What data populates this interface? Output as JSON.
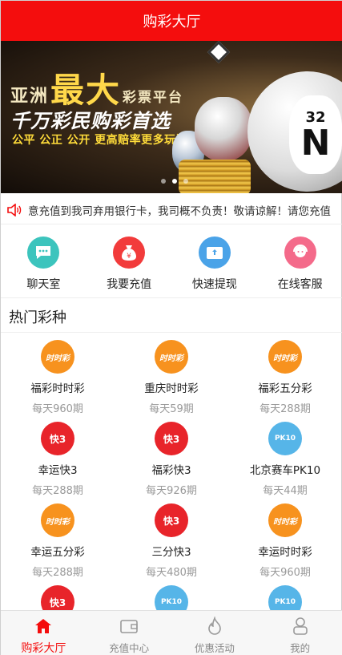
{
  "header": {
    "title": "购彩大厅"
  },
  "banner": {
    "line1_a": "亚洲",
    "line1_big": "最大",
    "line1_b": "彩票平台",
    "line2": "千万彩民购彩首选",
    "line3": "公平 公正 公开 更高赔率更多玩法",
    "ball_number": "32",
    "ball_letter": "N",
    "active_slide": 2,
    "slide_count": 3
  },
  "notice": {
    "text": "意充值到我司弃用银行卡，我司概不负责！敬请谅解！请您充值"
  },
  "quick_actions": [
    {
      "label": "聊天室",
      "icon": "chat-icon",
      "color": "#3cc4bd"
    },
    {
      "label": "我要充值",
      "icon": "money-bag-icon",
      "color": "#f23b3b"
    },
    {
      "label": "快速提现",
      "icon": "wallet-icon",
      "color": "#4aa3e8"
    },
    {
      "label": "在线客服",
      "icon": "customer-service-icon",
      "color": "#f46a8a"
    }
  ],
  "section": {
    "title": "热门彩种"
  },
  "lotteries": [
    {
      "name": "福彩时时彩",
      "count": "每天960期",
      "type": "ssc",
      "icon_text": "时时彩"
    },
    {
      "name": "重庆时时彩",
      "count": "每天59期",
      "type": "ssc",
      "icon_text": "时时彩"
    },
    {
      "name": "福彩五分彩",
      "count": "每天288期",
      "type": "ssc",
      "icon_text": "时时彩"
    },
    {
      "name": "幸运快3",
      "count": "每天288期",
      "type": "k3",
      "icon_text": "快3"
    },
    {
      "name": "福彩快3",
      "count": "每天926期",
      "type": "k3",
      "icon_text": "快3"
    },
    {
      "name": "北京赛车PK10",
      "count": "每天44期",
      "type": "pk10",
      "icon_text": "PK10"
    },
    {
      "name": "幸运五分彩",
      "count": "每天288期",
      "type": "ssc",
      "icon_text": "时时彩"
    },
    {
      "name": "三分快3",
      "count": "每天480期",
      "type": "k3",
      "icon_text": "快3"
    },
    {
      "name": "幸运时时彩",
      "count": "每天960期",
      "type": "ssc",
      "icon_text": "时时彩"
    },
    {
      "name": "",
      "count": "",
      "type": "k3",
      "icon_text": "快3"
    },
    {
      "name": "",
      "count": "",
      "type": "pk10",
      "icon_text": "PK10"
    },
    {
      "name": "",
      "count": "",
      "type": "pk10",
      "icon_text": "PK10"
    }
  ],
  "tabbar": [
    {
      "label": "购彩大厅",
      "icon": "home-icon",
      "active": true
    },
    {
      "label": "充值中心",
      "icon": "wallet-icon",
      "active": false
    },
    {
      "label": "优惠活动",
      "icon": "flame-icon",
      "active": false
    },
    {
      "label": "我的",
      "icon": "user-icon",
      "active": false
    }
  ],
  "colors": {
    "brand_red": "#f40d0d",
    "muted": "#999999"
  }
}
